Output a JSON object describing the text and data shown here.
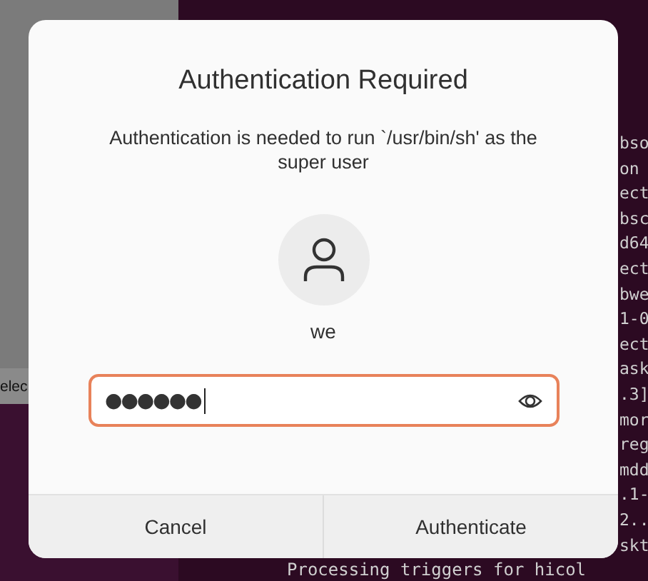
{
  "background": {
    "side_window": {
      "text": "elec"
    },
    "terminal": {
      "lines": [
        "bso",
        "on",
        "ect",
        "bsc",
        "d64",
        "ect",
        "bwe",
        "1-0",
        "ect",
        "ask",
        ".3]",
        "mor",
        "reg",
        "mdd",
        ".1-",
        "2..",
        "skt"
      ],
      "last_line": "Processing triggers for hicol"
    }
  },
  "dialog": {
    "title": "Authentication Required",
    "message": "Authentication is needed to run `/usr/bin/sh' as the super user",
    "user": {
      "name": "we"
    },
    "password": {
      "value": "●●●●●●",
      "focused": true
    },
    "buttons": [
      {
        "label": "Cancel"
      },
      {
        "label": "Authenticate"
      }
    ]
  }
}
